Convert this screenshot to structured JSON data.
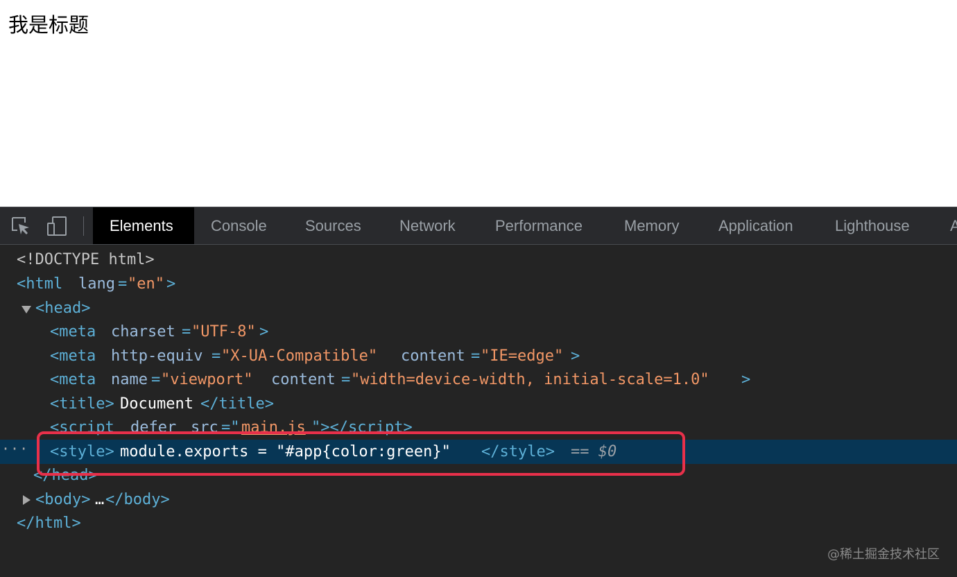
{
  "page": {
    "heading": "我是标题"
  },
  "devtools": {
    "icons": [
      "inspect-element-icon",
      "device-toolbar-icon"
    ],
    "tabs": [
      {
        "label": "Elements",
        "active": true
      },
      {
        "label": "Console",
        "active": false
      },
      {
        "label": "Sources",
        "active": false
      },
      {
        "label": "Network",
        "active": false
      },
      {
        "label": "Performance",
        "active": false
      },
      {
        "label": "Memory",
        "active": false
      },
      {
        "label": "Application",
        "active": false
      },
      {
        "label": "Lighthouse",
        "active": false
      },
      {
        "label": "A",
        "active": false
      }
    ],
    "tree": {
      "doctype": "<!DOCTYPE html>",
      "html_open": "<html",
      "html_lang_name": "lang",
      "html_lang_value": "\"en\"",
      "head_open": "<head>",
      "meta1_attr": "charset",
      "meta1_value": "\"UTF-8\"",
      "meta2_attr1": "http-equiv",
      "meta2_value1": "\"X-UA-Compatible\"",
      "meta2_attr2": "content",
      "meta2_value2": "\"IE=edge\"",
      "meta3_attr1": "name",
      "meta3_value1": "\"viewport\"",
      "meta3_attr2": "content",
      "meta3_value2": "\"width=device-width, initial-scale=1.0\"",
      "title_text": "Document",
      "script_open": "<script",
      "script_attr1": "defer",
      "script_attr2": "src",
      "script_src_value": "main.js",
      "style_text": "module.exports = \"#app{color:green}\"",
      "selected_ref": "== $0",
      "head_close": "</head>",
      "body_collapsed": "…",
      "html_close": "</html>"
    }
  },
  "watermark": "@稀土掘金技术社区",
  "colors": {
    "selected_row": "#073655",
    "highlight_box": "#e8304a",
    "active_tab": "#000000"
  }
}
